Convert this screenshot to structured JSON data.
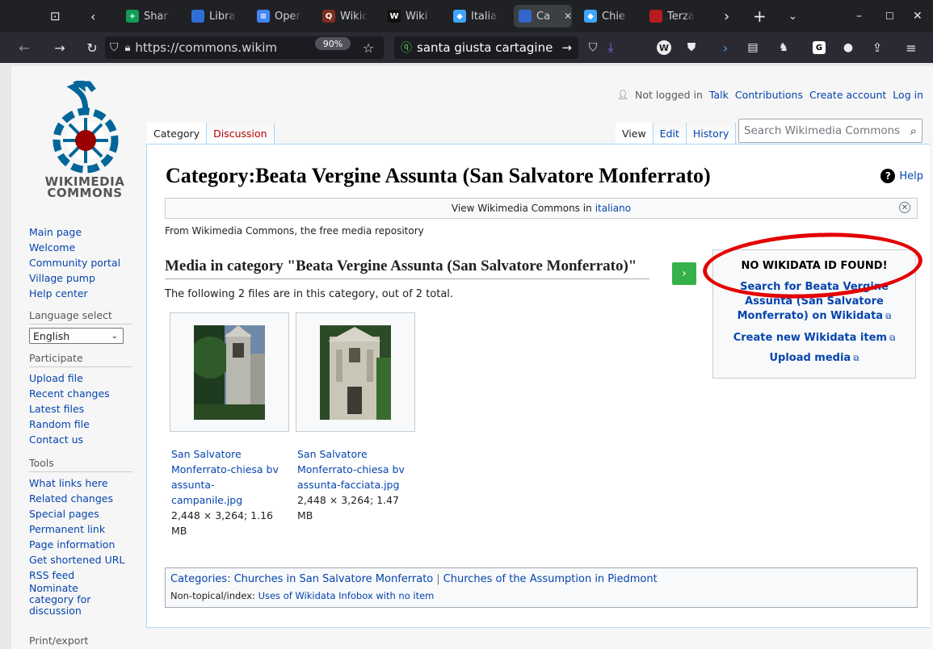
{
  "browser": {
    "tabs": [
      {
        "label": "Shar",
        "fav_color": "#0f9d58",
        "fav_glyph": "+"
      },
      {
        "label": "Libra",
        "fav_color": "#2d6fd6",
        "fav_glyph": ""
      },
      {
        "label": "Oper",
        "fav_color": "#4285f4",
        "fav_glyph": "≡"
      },
      {
        "label": "Wikic",
        "fav_color": "#7e2f1f",
        "fav_glyph": "Q"
      },
      {
        "label": "Wiki",
        "fav_color": "#111",
        "fav_glyph": "W"
      },
      {
        "label": "Italia",
        "fav_color": "#3ea6ff",
        "fav_glyph": "◆"
      },
      {
        "label": "Ca",
        "fav_color": "#3366cc",
        "fav_glyph": ""
      },
      {
        "label": "Chie",
        "fav_color": "#3ea6ff",
        "fav_glyph": "◆"
      },
      {
        "label": "Terza",
        "fav_color": "#b71c1c",
        "fav_glyph": ""
      }
    ],
    "url": "https://commons.wikim",
    "zoom": "90%",
    "search_text": "santa giusta cartagine"
  },
  "logo": {
    "line1": "WIKIMEDIA",
    "line2": "COMMONS"
  },
  "sidebar": {
    "nav": [
      "Main page",
      "Welcome",
      "Community portal",
      "Village pump",
      "Help center"
    ],
    "language_heading": "Language select",
    "language_value": "English",
    "participate_heading": "Participate",
    "participate": [
      "Upload file",
      "Recent changes",
      "Latest files",
      "Random file",
      "Contact us"
    ],
    "tools_heading": "Tools",
    "tools": [
      "What links here",
      "Related changes",
      "Special pages",
      "Permanent link",
      "Page information",
      "Get shortened URL",
      "RSS feed",
      "Nominate category for discussion"
    ],
    "print_heading": "Print/export"
  },
  "personal": {
    "status": "Not logged in",
    "links": [
      "Talk",
      "Contributions",
      "Create account",
      "Log in"
    ]
  },
  "page_tabs": {
    "left": [
      "Category",
      "Discussion"
    ],
    "right": [
      "View",
      "Edit",
      "History"
    ]
  },
  "search": {
    "placeholder": "Search Wikimedia Commons"
  },
  "content": {
    "title": "Category:Beata Vergine Assunta (San Salvatore Monferrato)",
    "help": "Help",
    "banner_text": "View Wikimedia Commons in",
    "banner_link": "italiano",
    "sitesub": "From Wikimedia Commons, the free media repository",
    "media_heading": "Media in category \"Beata Vergine Assunta (San Salvatore Monferrato)\"",
    "file_count": "The following 2 files are in this category, out of 2 total.",
    "files": [
      {
        "name_lines": [
          "San Salvatore",
          "Monferrato-chiesa bv",
          "assunta-",
          "campanile.jpg"
        ],
        "info_lines": [
          "2,448 × 3,264; 1.16",
          "MB"
        ]
      },
      {
        "name_lines": [
          "San Salvatore",
          "Monferrato-chiesa bv",
          "assunta-facciata.jpg"
        ],
        "info_lines": [
          "2,448 × 3,264; 1.47",
          "MB"
        ]
      }
    ]
  },
  "infobox": {
    "no_id": "NO WIKIDATA ID FOUND!",
    "search_lines": [
      "Search for Beata Vergine",
      "Assunta (San Salvatore",
      "Monferrato) on Wikidata"
    ],
    "create": "Create new Wikidata item",
    "upload": "Upload media"
  },
  "categories": {
    "label": "Categories:",
    "items": [
      "Churches in San Salvatore Monferrato",
      "Churches of the Assumption in Piedmont"
    ],
    "hidden_label": "Non-topical/index:",
    "hidden_item": "Uses of Wikidata Infobox with no item"
  },
  "colors": {
    "link": "#0645ad",
    "redlink": "#ba0000",
    "annotation": "#e30000",
    "wikidata_button": "#36b14a"
  }
}
